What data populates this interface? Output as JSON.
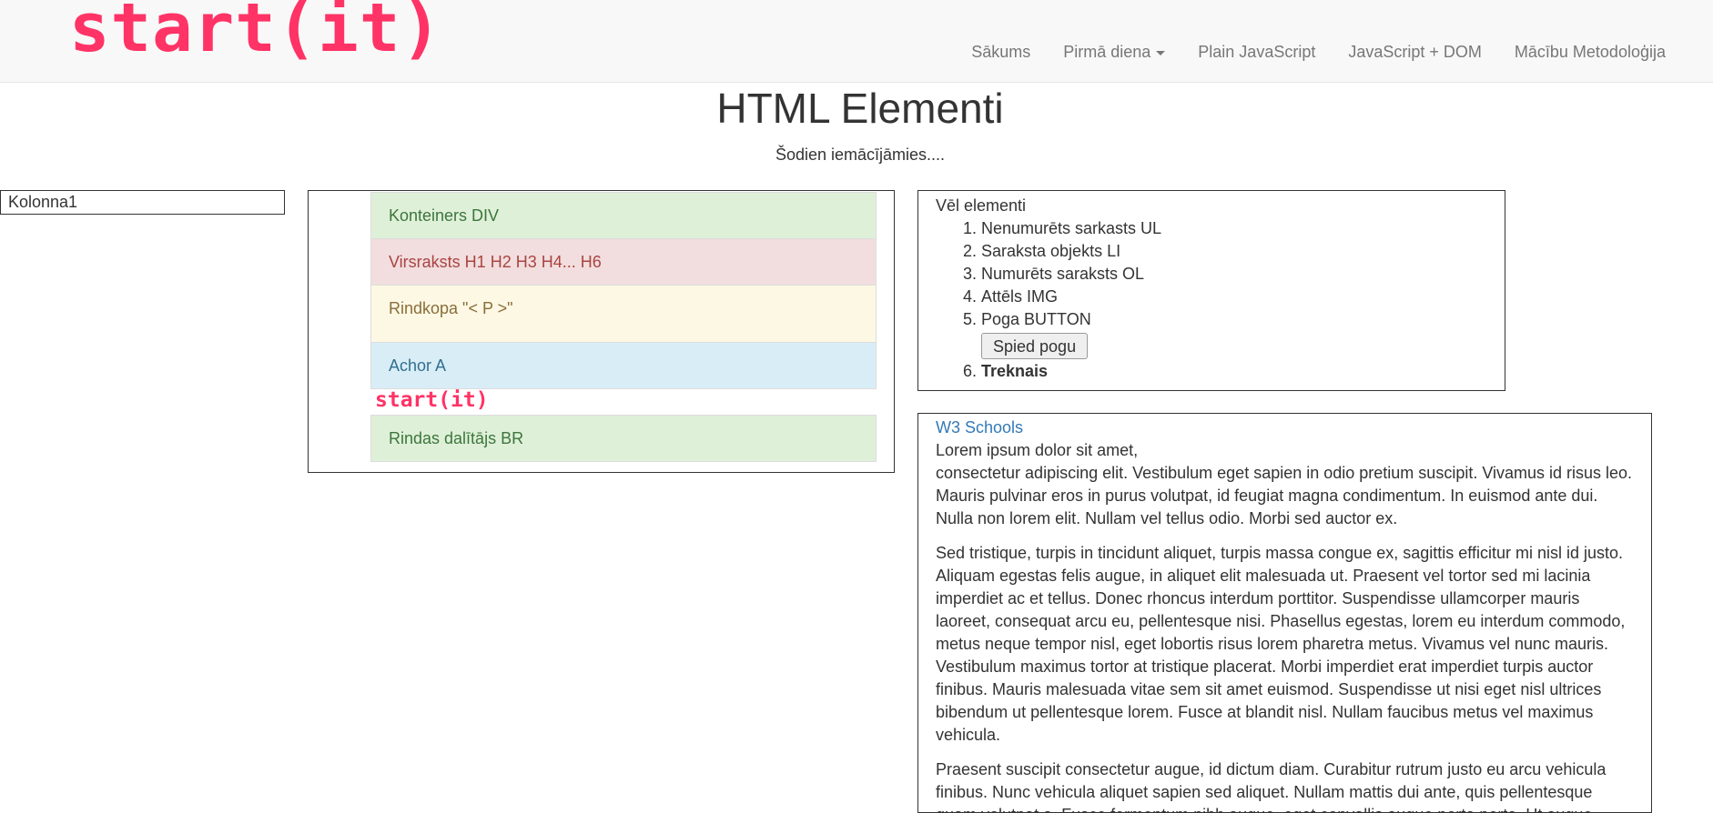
{
  "navbar": {
    "brand": "start(it)",
    "items": [
      {
        "label": "Sākums"
      },
      {
        "label": "Pirmā diena"
      },
      {
        "label": "Plain JavaScript"
      },
      {
        "label": "JavaScript + DOM"
      },
      {
        "label": "Mācību Metodoloģija"
      }
    ]
  },
  "header": {
    "title": "HTML Elementi",
    "lead": "Šodien iemācījāmies...."
  },
  "column1": {
    "label": "Kolonna1"
  },
  "column2": {
    "items": [
      {
        "label": "Konteiners DIV"
      },
      {
        "label": "Virsraksts H1 H2 H3 H4... H6"
      },
      {
        "label": "Rindkopa \"< P >\""
      },
      {
        "label": "Achor A"
      },
      {
        "label": "Rindas dalītājs BR"
      }
    ],
    "logo": "start(it)"
  },
  "column3": {
    "box1": {
      "heading": "Vēl elementi",
      "items": [
        {
          "label": "Nenumurēts sarkasts UL"
        },
        {
          "label": "Saraksta objekts LI"
        },
        {
          "label": "Numurēts saraksts OL"
        },
        {
          "label": "Attēls IMG"
        },
        {
          "label": "Poga BUTTON"
        },
        {
          "label": "Treknais"
        }
      ],
      "button_label": "Spied pogu"
    },
    "box2": {
      "link": "W3 Schools",
      "first_line": "Lorem ipsum dolor sit amet,",
      "paragraph1": "consectetur adipiscing elit. Vestibulum eget sapien in odio pretium suscipit. Vivamus id risus leo. Mauris pulvinar eros in purus volutpat, id feugiat magna condimentum. In euismod ante dui. Nulla non lorem elit. Nullam vel tellus odio. Morbi sed auctor ex.",
      "paragraph2": "Sed tristique, turpis in tincidunt aliquet, turpis massa congue ex, sagittis efficitur mi nisl id justo. Aliquam egestas felis augue, in aliquet elit malesuada ut. Praesent vel tortor sed mi lacinia imperdiet ac et tellus. Donec rhoncus interdum porttitor. Suspendisse ullamcorper mauris laoreet, consequat arcu eu, pellentesque nisi. Phasellus egestas, lorem eu interdum commodo, metus neque tempor nisl, eget lobortis risus lorem pharetra metus. Vivamus vel nunc mauris. Vestibulum maximus tortor at tristique placerat. Morbi imperdiet erat imperdiet turpis auctor finibus. Mauris malesuada vitae sem sit amet euismod. Suspendisse ut nisi eget nisl ultrices bibendum ut pellentesque lorem. Fusce at blandit nisl. Nullam faucibus metus vel maximus vehicula.",
      "paragraph3": "Praesent suscipit consectetur augue, id dictum diam. Curabitur rutrum justo eu arcu vehicula finibus. Nunc vehicula aliquet sapien sed aliquet. Nullam mattis dui ante, quis pellentesque quam volutpat a. Fusce fermentum nibh augue, eget convallis augue porta porta. Ut augue quam,"
    }
  },
  "colors": {
    "brand": "#ff3366",
    "navbar_bg": "#f8f8f8",
    "success_bg": "#dff0d8",
    "danger_bg": "#f2dede",
    "warning_bg": "#fcf8e3",
    "info_bg": "#d9edf7",
    "link": "#337ab7"
  }
}
